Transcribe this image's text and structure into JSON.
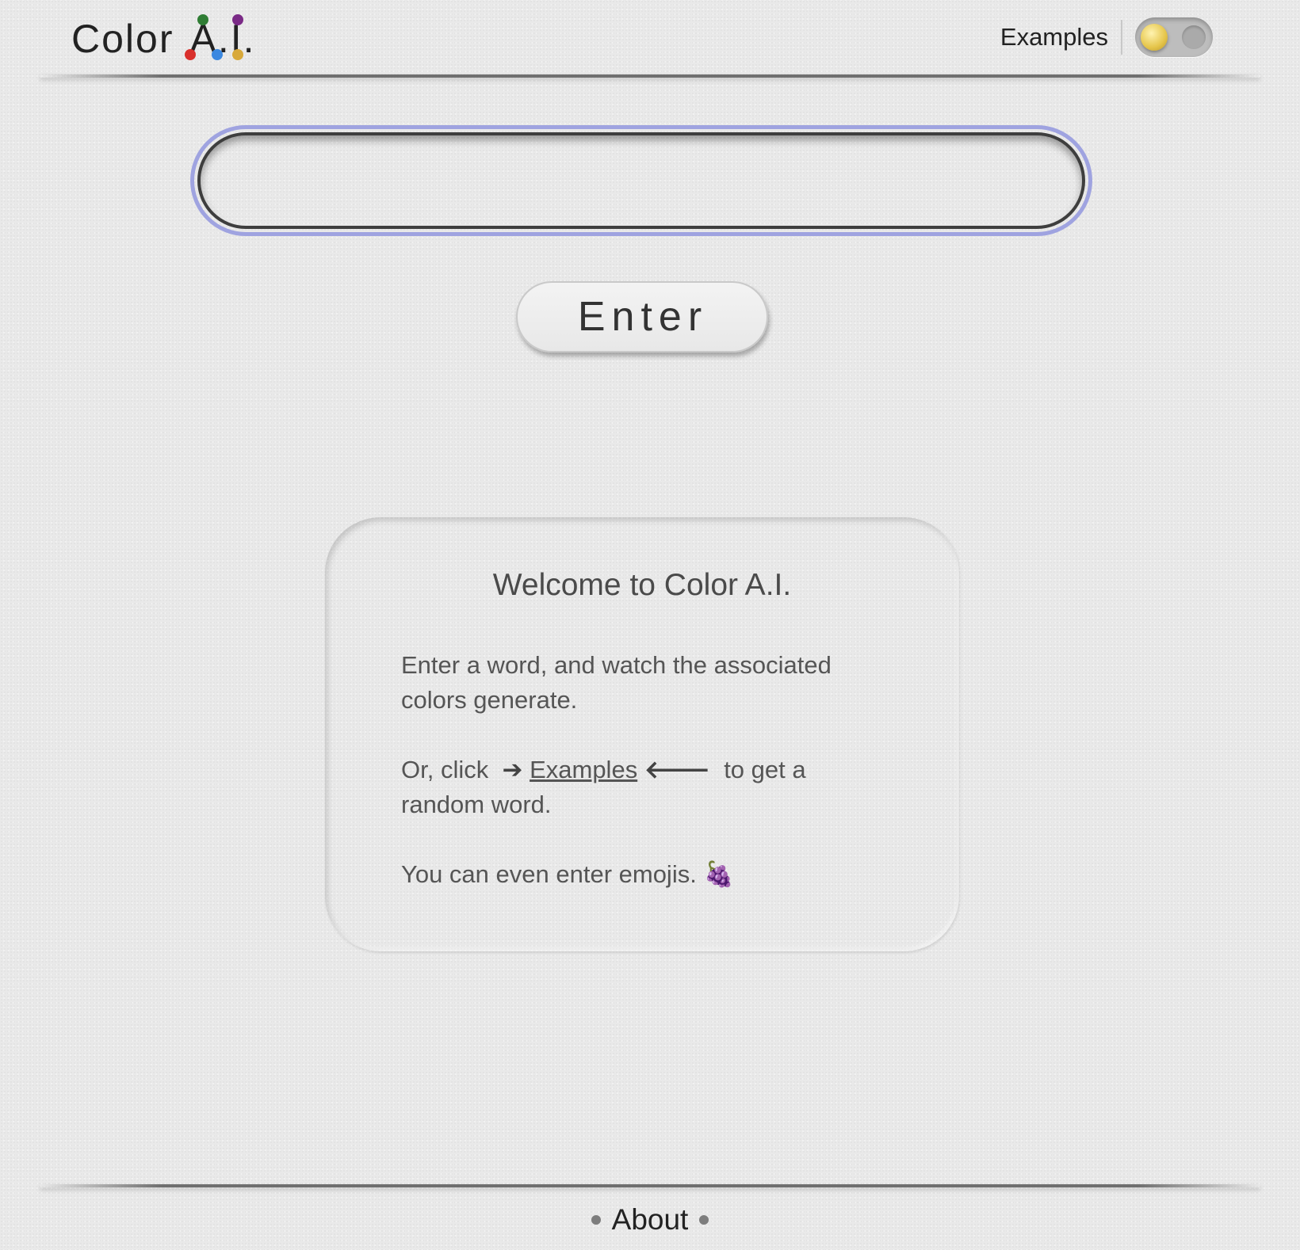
{
  "header": {
    "logo_word": "Color",
    "logo_ai": "A.I.",
    "logo_dot_colors": [
      "#d9302c",
      "#2f7d34",
      "#3b88e0",
      "#7a2a86",
      "#d8a93a"
    ],
    "examples_label": "Examples",
    "theme_toggle": {
      "state": "light",
      "sun_icon": "sun-icon",
      "moon_icon": "moon-icon"
    }
  },
  "search": {
    "value": "",
    "placeholder": "",
    "focus_ring_color": "#9fa3e0"
  },
  "enter_button": {
    "label": "Enter"
  },
  "welcome": {
    "title": "Welcome to Color A.I.",
    "line1": "Enter a word, and watch the associated colors generate.",
    "line2_prefix": "Or, click",
    "arrow_right": "➔",
    "examples_link": "Examples",
    "arrow_left": "🡐",
    "line2_suffix": "to get a random word.",
    "line3": "You can even enter emojis.",
    "emoji": "🍇"
  },
  "footer": {
    "about_label": "About"
  }
}
